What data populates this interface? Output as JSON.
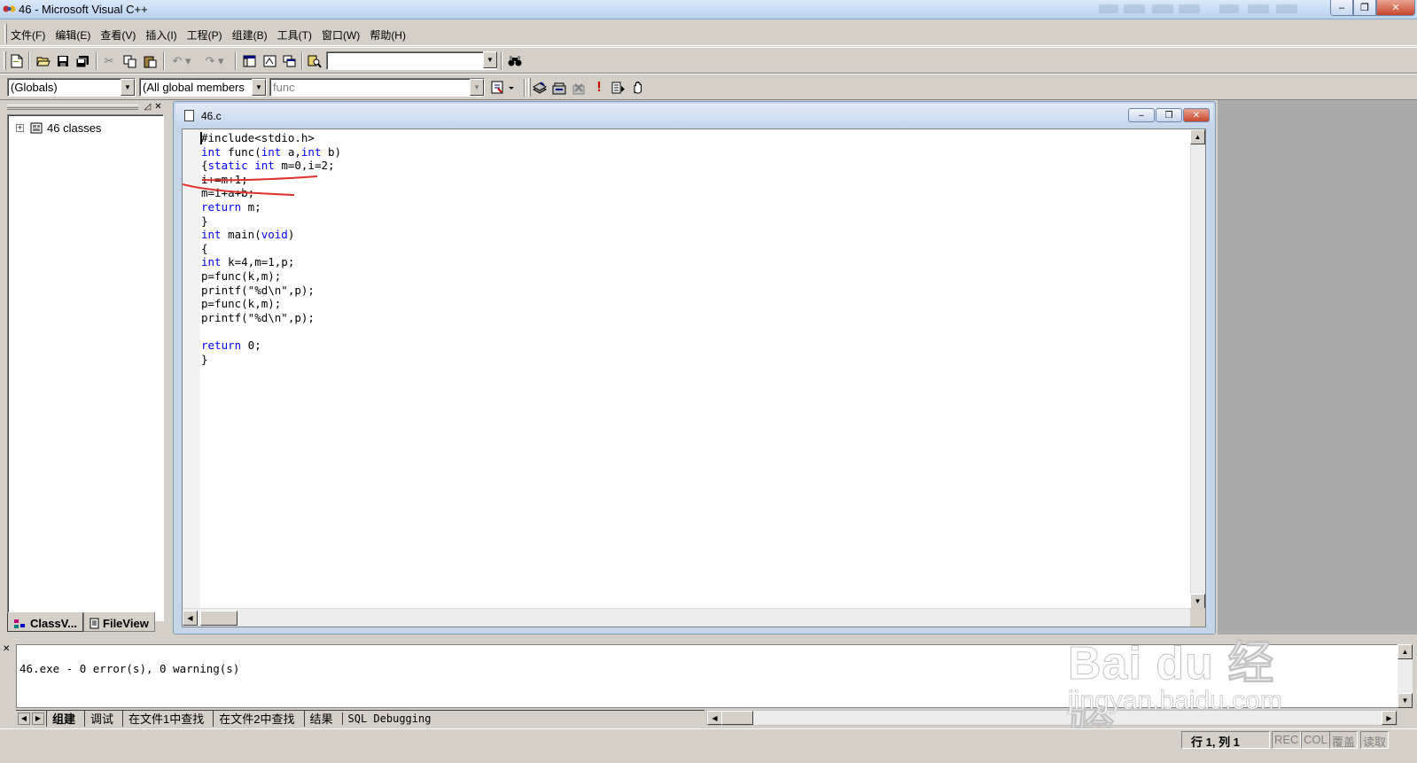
{
  "window": {
    "title": "46 - Microsoft Visual C++",
    "controls": {
      "minimize": "‒",
      "restore": "❐",
      "close": "✕"
    }
  },
  "menu": {
    "items": [
      "文件(F)",
      "编辑(E)",
      "查看(V)",
      "插入(I)",
      "工程(P)",
      "组建(B)",
      "工具(T)",
      "窗口(W)",
      "帮助(H)"
    ]
  },
  "toolbar": {
    "icons": [
      "new-file-icon",
      "open-icon",
      "save-icon",
      "save-all-icon",
      "cut-icon",
      "copy-icon",
      "paste-icon",
      "undo-icon",
      "redo-icon",
      "workspace-icon",
      "output-icon",
      "window-list-icon",
      "find-in-files-icon",
      "find-icon"
    ],
    "find_combo_value": ""
  },
  "wizardbar": {
    "class_combo": "(Globals)",
    "filter_combo": "(All global members",
    "member_combo": "func",
    "icons": [
      "wizard-action-icon",
      "compile-icon",
      "build-icon",
      "stop-build-icon",
      "execute-icon",
      "go-icon",
      "breakpoint-icon"
    ]
  },
  "workspace": {
    "tree_root": "46 classes",
    "tabs": [
      "ClassV...",
      "FileView"
    ]
  },
  "editor": {
    "filename": "46.c",
    "code_lines": [
      [
        {
          "t": "#include<stdio.h>",
          "k": 0
        }
      ],
      [
        {
          "t": "int",
          "k": 1
        },
        {
          "t": " func(",
          "k": 0
        },
        {
          "t": "int",
          "k": 1
        },
        {
          "t": " a,",
          "k": 0
        },
        {
          "t": "int",
          "k": 1
        },
        {
          "t": " b)",
          "k": 0
        }
      ],
      [
        {
          "t": "{",
          "k": 0
        },
        {
          "t": "static",
          "k": 1
        },
        {
          "t": " ",
          "k": 0
        },
        {
          "t": "int",
          "k": 1
        },
        {
          "t": " m=0,i=2;",
          "k": 0
        }
      ],
      [
        {
          "t": "i+=m+1;",
          "k": 0
        }
      ],
      [
        {
          "t": "m=i+a+b;",
          "k": 0
        }
      ],
      [
        {
          "t": "return",
          "k": 1
        },
        {
          "t": " m;",
          "k": 0
        }
      ],
      [
        {
          "t": "}",
          "k": 0
        }
      ],
      [
        {
          "t": "int",
          "k": 1
        },
        {
          "t": " main(",
          "k": 0
        },
        {
          "t": "void",
          "k": 1
        },
        {
          "t": ")",
          "k": 0
        }
      ],
      [
        {
          "t": "{",
          "k": 0
        }
      ],
      [
        {
          "t": "int",
          "k": 1
        },
        {
          "t": " k=4,m=1,p;",
          "k": 0
        }
      ],
      [
        {
          "t": "p=func(k,m);",
          "k": 0
        }
      ],
      [
        {
          "t": "printf(\"%d\\n\",p);",
          "k": 0
        }
      ],
      [
        {
          "t": "p=func(k,m);",
          "k": 0
        }
      ],
      [
        {
          "t": "printf(\"%d\\n\",p);",
          "k": 0
        }
      ],
      [
        {
          "t": "",
          "k": 0
        }
      ],
      [
        {
          "t": "return",
          "k": 1
        },
        {
          "t": " 0;",
          "k": 0
        }
      ],
      [
        {
          "t": "}",
          "k": 0
        }
      ]
    ],
    "keyword_color": "#0000ff",
    "annotation_color": "#e0302a"
  },
  "output": {
    "message": "46.exe - 0 error(s), 0 warning(s)",
    "tabs": [
      "组建",
      "调试",
      "在文件1中查找",
      "在文件2中查找",
      "结果",
      "SQL Debugging"
    ]
  },
  "status": {
    "position": "行 1, 列 1",
    "indicators": [
      "REC",
      "COL",
      "覆盖",
      "读取"
    ]
  },
  "watermark": {
    "logo": "Bai du 经验",
    "url": "jingyan.baidu.com"
  }
}
